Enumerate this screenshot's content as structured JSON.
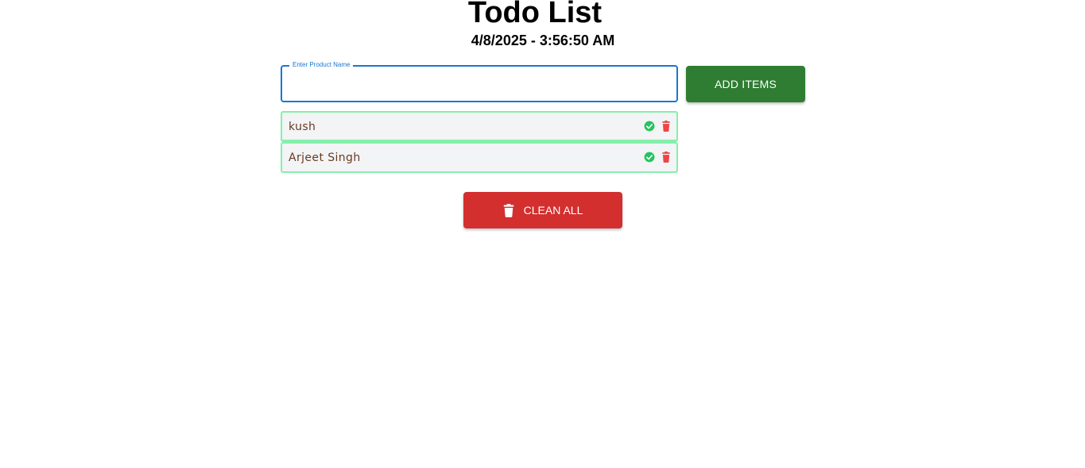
{
  "header": {
    "title": "Todo List",
    "datetime": "4/8/2025 - 3:56:50 AM"
  },
  "form": {
    "input_label": "Enter Product Name",
    "input_value": "",
    "add_button_label": "ADD ITEMS"
  },
  "todos": [
    {
      "text": "kush",
      "check_icon": "check-circle-icon",
      "delete_icon": "trash-icon"
    },
    {
      "text": "Arjeet Singh",
      "check_icon": "check-circle-icon",
      "delete_icon": "trash-icon"
    }
  ],
  "actions": {
    "clean_all_label": "CLEAN ALL",
    "clean_all_icon": "trash-icon"
  },
  "colors": {
    "primary": "#1976d2",
    "success": "#2e7d32",
    "danger": "#d32f2f",
    "item_border": "#86efac",
    "check_green": "#22c55e",
    "delete_red": "#ef4444"
  }
}
